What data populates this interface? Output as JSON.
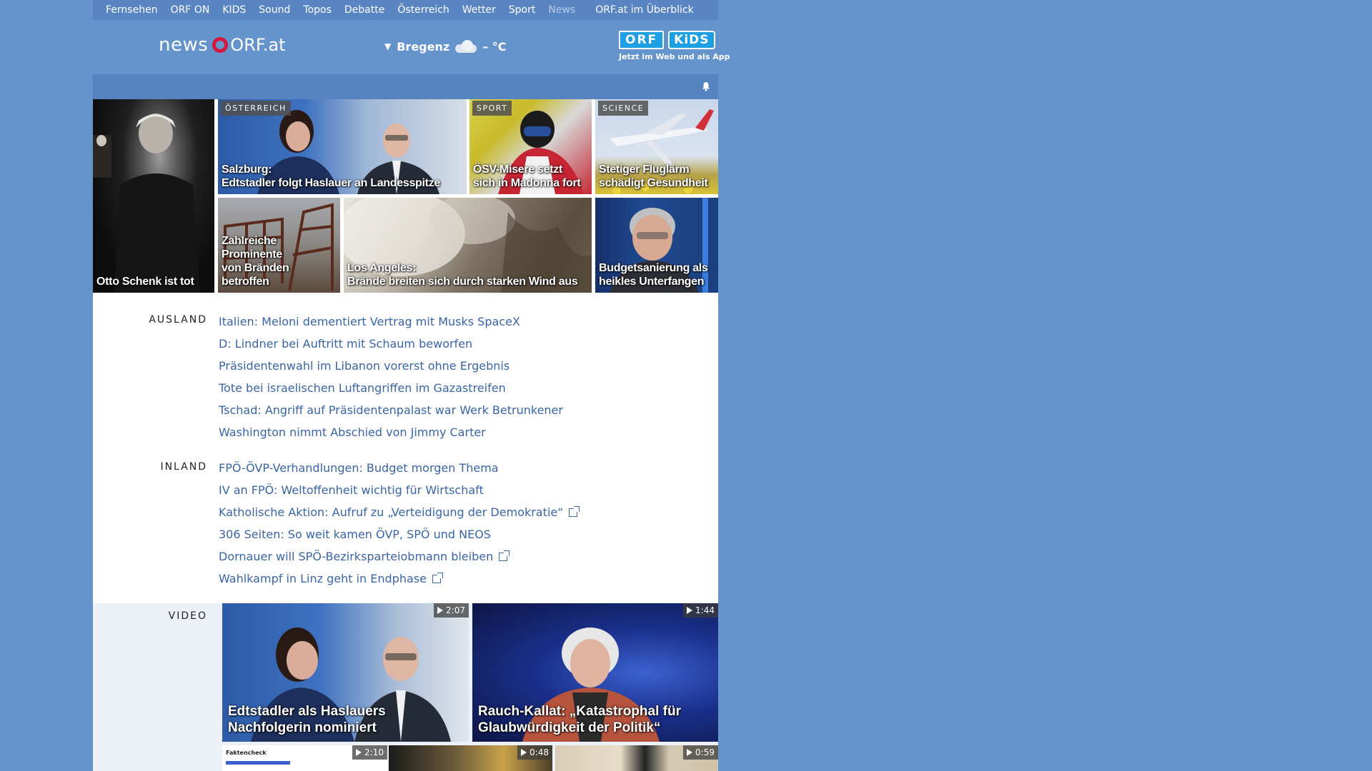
{
  "topnav": {
    "items": [
      "Fernsehen",
      "ORF ON",
      "KIDS",
      "Sound",
      "Topos",
      "Debatte",
      "Österreich",
      "Wetter",
      "Sport",
      "News"
    ],
    "active": "News",
    "overview": "ORF.at im Überblick"
  },
  "header": {
    "logo_news": "news",
    "logo_orf": "ORF.at",
    "weather_city": "Bregenz",
    "weather_temp": "– °C",
    "kids_orf": "ORF",
    "kids_kids": "KiDS",
    "kids_tagline": "Jetzt im Web und als App"
  },
  "teasers": [
    {
      "title": "Otto Schenk ist tot",
      "category": ""
    },
    {
      "title": "Salzburg:\nEdtstadler folgt Haslauer an Landesspitze",
      "category": "ÖSTERREICH"
    },
    {
      "title": "ÖSV-Misere setzt\nsich in Madonna fort",
      "category": "SPORT"
    },
    {
      "title": "Stetiger Fluglärm\nschädigt Gesundheit",
      "category": "SCIENCE"
    },
    {
      "title": "Zahlreiche Prominente\nvon Bränden betroffen",
      "category": ""
    },
    {
      "title": "Los Angeles:\nBrände breiten sich durch starken Wind aus",
      "category": ""
    },
    {
      "title": "Budgetsanierung als\nheikles Unterfangen",
      "category": ""
    }
  ],
  "ausland": {
    "label": "AUSLAND",
    "links": [
      "Italien: Meloni dementiert Vertrag mit Musks SpaceX",
      "D: Lindner bei Auftritt mit Schaum beworfen",
      "Präsidentenwahl im Libanon vorerst ohne Ergebnis",
      "Tote bei israelischen Luftangriffen im Gazastreifen",
      "Tschad: Angriff auf Präsidentenpalast war Werk Betrunkener",
      "Washington nimmt Abschied von Jimmy Carter"
    ]
  },
  "inland": {
    "label": "INLAND",
    "links": [
      {
        "text": "FPÖ-ÖVP-Verhandlungen: Budget morgen Thema",
        "external": false
      },
      {
        "text": "IV an FPÖ: Weltoffenheit wichtig für Wirtschaft",
        "external": false
      },
      {
        "text": "Katholische Aktion: Aufruf zu „Verteidigung der Demokratie“",
        "external": true
      },
      {
        "text": "306 Seiten: So weit kamen ÖVP, SPÖ und NEOS",
        "external": false
      },
      {
        "text": "Dornauer will SPÖ-Bezirksparteiobmann bleiben",
        "external": true
      },
      {
        "text": "Wahlkampf in Linz geht in Endphase",
        "external": true
      }
    ]
  },
  "video": {
    "label": "VIDEO",
    "items": [
      {
        "title": "Edtstadler als Haslauers Nachfolgerin nominiert",
        "duration": "2:07"
      },
      {
        "title": "Rauch-Kallat: „Katastrophal für Glaubwürdigkeit der Politik“",
        "duration": "1:44"
      },
      {
        "title": "",
        "duration": "2:10",
        "thumb_label": "Faktencheck"
      },
      {
        "title": "",
        "duration": "0:48"
      },
      {
        "title": "",
        "duration": "0:59"
      }
    ]
  }
}
